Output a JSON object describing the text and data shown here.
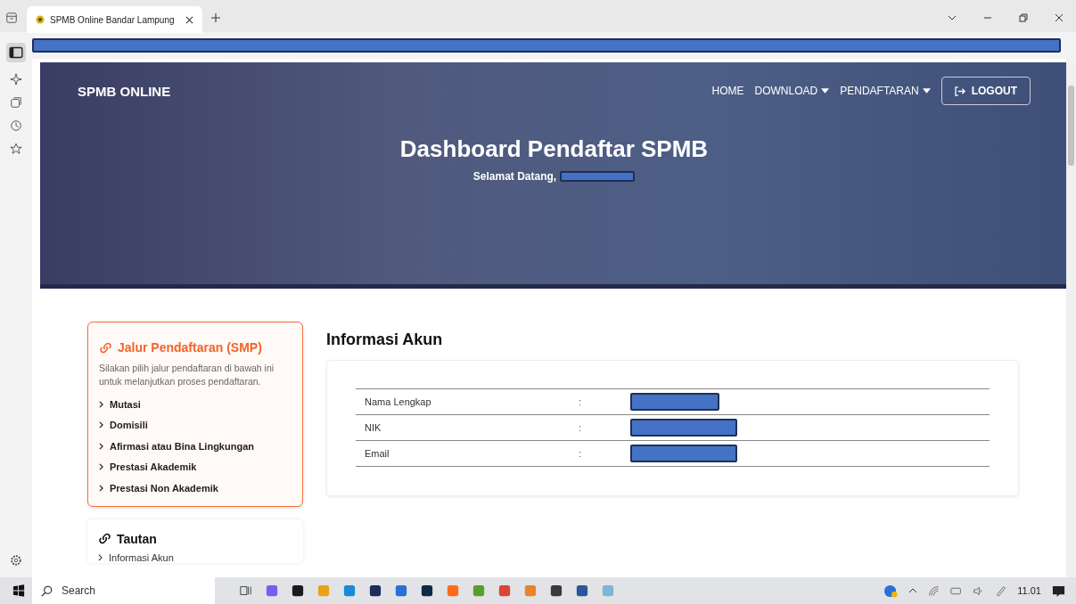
{
  "browser": {
    "tab_title": "SPMB Online Bandar Lampung"
  },
  "navbar": {
    "brand": "SPMB ONLINE",
    "links": [
      {
        "label": "HOME",
        "dropdown": false
      },
      {
        "label": "DOWNLOAD",
        "dropdown": true
      },
      {
        "label": "PENDAFTARAN",
        "dropdown": true
      }
    ],
    "logout": "LOGOUT"
  },
  "hero": {
    "title": "Dashboard Pendaftar SPMB",
    "greeting": "Selamat Datang,"
  },
  "jalur_card": {
    "title": "Jalur Pendaftaran (SMP)",
    "description": "Silakan pilih jalur pendaftaran di bawah ini untuk melanjutkan proses pendaftaran.",
    "items": [
      "Mutasi",
      "Domisili",
      "Afirmasi atau Bina Lingkungan",
      "Prestasi Akademik",
      "Prestasi Non Akademik"
    ]
  },
  "tautan_card": {
    "title": "Tautan",
    "items": [
      "Informasi Akun"
    ]
  },
  "account_info": {
    "title": "Informasi Akun",
    "rows": [
      {
        "label": "Nama Lengkap",
        "separator": ":"
      },
      {
        "label": "NIK",
        "separator": ":"
      },
      {
        "label": "Email",
        "separator": ":"
      }
    ]
  },
  "taskbar": {
    "search_placeholder": "Search",
    "time": "11.01"
  }
}
